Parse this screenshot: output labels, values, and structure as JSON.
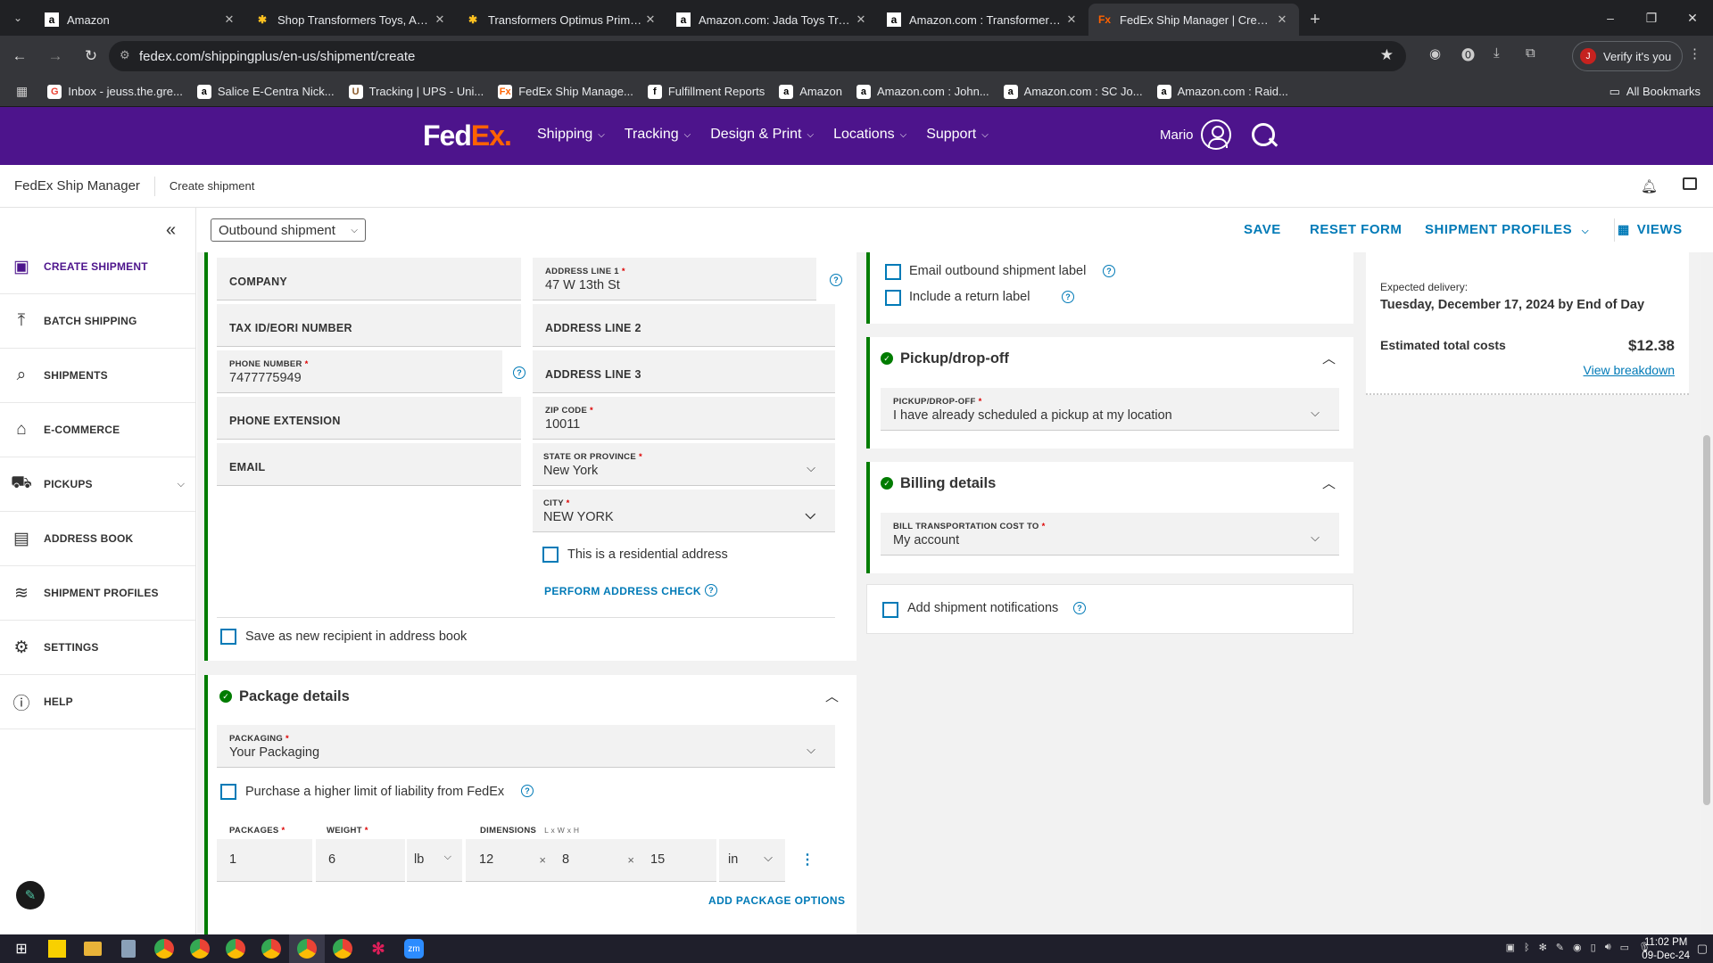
{
  "browser": {
    "tabs": [
      {
        "title": "Amazon",
        "icon": "a",
        "icon_bg": "#fff",
        "icon_color": "#000"
      },
      {
        "title": "Shop Transformers Toys, Action",
        "icon": "✱",
        "icon_bg": "transparent",
        "icon_color": "#ffc220"
      },
      {
        "title": "Transformers Optimus Prime RC",
        "icon": "✱",
        "icon_bg": "transparent",
        "icon_color": "#ffc220"
      },
      {
        "title": "Amazon.com: Jada Toys Transfo",
        "icon": "a",
        "icon_bg": "#fff",
        "icon_color": "#000"
      },
      {
        "title": "Amazon.com : Transformers Op",
        "icon": "a",
        "icon_bg": "#fff",
        "icon_color": "#000"
      },
      {
        "title": "FedEx Ship Manager | Create sh",
        "icon": "Fx",
        "icon_bg": "transparent",
        "icon_color": "#ff6200"
      }
    ],
    "url": "fedex.com/shippingplus/en-us/shipment/create",
    "verify_label": "Verify it's you",
    "profile_initial": "J",
    "bookmarks": [
      {
        "label": "Inbox - jeuss.the.gre...",
        "icon": "G",
        "color": "#ea4335"
      },
      {
        "label": "Salice E-Centra Nick...",
        "icon": "a",
        "color": "#000"
      },
      {
        "label": "Tracking | UPS - Uni...",
        "icon": "U",
        "color": "#8b5a2b"
      },
      {
        "label": "FedEx Ship Manage...",
        "icon": "Fx",
        "color": "#ff6200"
      },
      {
        "label": "Fulfillment Reports",
        "icon": "f",
        "color": "#000"
      },
      {
        "label": "Amazon",
        "icon": "a",
        "color": "#000"
      },
      {
        "label": "Amazon.com : John...",
        "icon": "a",
        "color": "#000"
      },
      {
        "label": "Amazon.com : SC Jo...",
        "icon": "a",
        "color": "#000"
      },
      {
        "label": "Amazon.com : Raid...",
        "icon": "a",
        "color": "#000"
      }
    ],
    "all_bookmarks": "All Bookmarks"
  },
  "fedex": {
    "logo_fed": "Fed",
    "logo_ex": "Ex",
    "logo_dot": ".",
    "nav": [
      "Shipping",
      "Tracking",
      "Design & Print",
      "Locations",
      "Support"
    ],
    "user_name": "Mario"
  },
  "app": {
    "name": "FedEx Ship Manager",
    "breadcrumb": "Create shipment"
  },
  "sidebar": [
    {
      "label": "CREATE SHIPMENT",
      "icon": "▣",
      "name": "create-shipment"
    },
    {
      "label": "BATCH SHIPPING",
      "icon": "⤒",
      "name": "batch-shipping"
    },
    {
      "label": "SHIPMENTS",
      "icon": "⌕",
      "name": "shipments"
    },
    {
      "label": "E-COMMERCE",
      "icon": "⌂",
      "name": "e-commerce"
    },
    {
      "label": "PICKUPS",
      "icon": "⛟",
      "name": "pickups"
    },
    {
      "label": "ADDRESS BOOK",
      "icon": "▤",
      "name": "address-book"
    },
    {
      "label": "SHIPMENT PROFILES",
      "icon": "≋",
      "name": "shipment-profiles"
    },
    {
      "label": "SETTINGS",
      "icon": "⚙",
      "name": "settings"
    },
    {
      "label": "HELP",
      "icon": "ⓘ",
      "name": "help"
    }
  ],
  "toolbar": {
    "shipment_type": "Outbound shipment",
    "save": "SAVE",
    "reset": "RESET FORM",
    "profiles": "SHIPMENT PROFILES",
    "views": "VIEWS"
  },
  "recipient": {
    "company_ph": "COMPANY",
    "tax_ph": "TAX ID/EORI NUMBER",
    "phone_label": "PHONE NUMBER",
    "phone_value": "7477775949",
    "phone_ext_ph": "PHONE EXTENSION",
    "email_ph": "EMAIL",
    "addr1_label": "ADDRESS LINE 1",
    "addr1_value": "47 W 13th St",
    "addr2_ph": "ADDRESS LINE 2",
    "addr3_ph": "ADDRESS LINE 3",
    "zip_label": "ZIP CODE",
    "zip_value": "10011",
    "state_label": "STATE OR PROVINCE",
    "state_value": "New York",
    "city_label": "CITY",
    "city_value": "NEW YORK",
    "residential_label": "This is a residential address",
    "address_check": "PERFORM ADDRESS CHECK",
    "save_recipient": "Save as new recipient in address book"
  },
  "package": {
    "title": "Package details",
    "packaging_label": "PACKAGING",
    "packaging_value": "Your Packaging",
    "liability_label": "Purchase a higher limit of liability from FedEx",
    "packages_label": "PACKAGES",
    "packages_value": "1",
    "weight_label": "WEIGHT",
    "weight_value": "6",
    "weight_unit": "lb",
    "dims_label": "DIMENSIONS",
    "dims_hint": "L x W x H",
    "length": "12",
    "width": "8",
    "height": "15",
    "dim_unit": "in",
    "add_options": "ADD PACKAGE OPTIONS"
  },
  "options": {
    "email_label": "Email outbound shipment label",
    "return_label": "Include a return label"
  },
  "pickup": {
    "title": "Pickup/drop-off",
    "label": "PICKUP/DROP-OFF",
    "value": "I have already scheduled a pickup at my location"
  },
  "billing": {
    "title": "Billing details",
    "label": "BILL TRANSPORTATION COST TO",
    "value": "My account"
  },
  "notifications": {
    "label": "Add shipment notifications"
  },
  "summary": {
    "expected_label": "Expected delivery:",
    "expected_value": "Tuesday, December 17, 2024 by End of Day",
    "cost_label": "Estimated total costs",
    "cost_value": "$12.38",
    "breakdown": "View breakdown"
  },
  "taskbar": {
    "time": "11:02 PM",
    "date": "09-Dec-24"
  }
}
